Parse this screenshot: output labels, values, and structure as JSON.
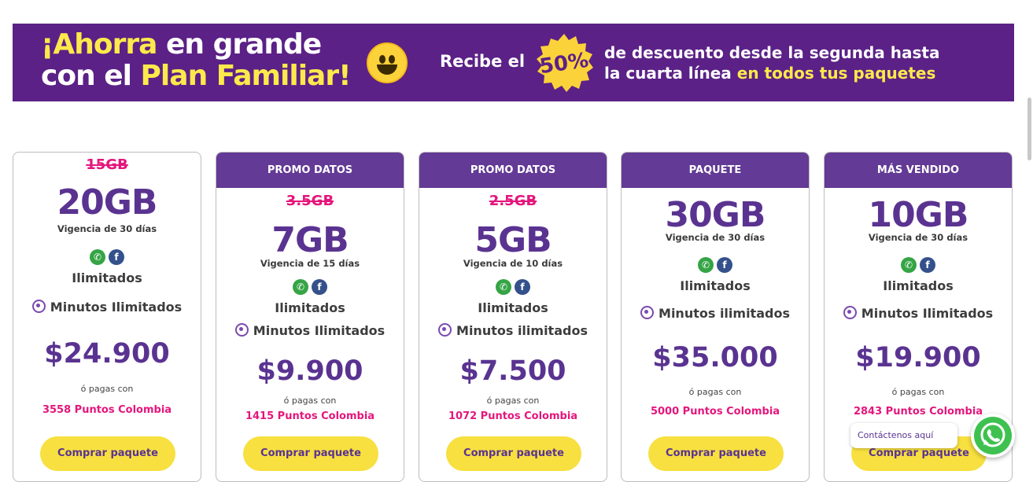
{
  "banner": {
    "line1_yellow": "¡Ahorra",
    "line1_white": "en grande",
    "line2_white": "con el",
    "line2_yellow": "Plan Familiar!",
    "recibe": "Recibe el",
    "percent": "50%",
    "desc_line1": "de descuento desde la segunda hasta",
    "desc_line2_white": "la cuarta línea",
    "desc_line2_yellow": "en todos tus paquetes",
    "bg_color": "#5b2187",
    "accent_color": "#fde94b"
  },
  "cards": [
    {
      "header": "",
      "old": "15GB",
      "gb": "20GB",
      "validity": "Vigencia de 30 días",
      "social_icons": [
        "whatsapp-icon",
        "facebook-icon"
      ],
      "unlimited": "Ilimitados",
      "minutes": "Minutos Ilimitados",
      "price": "$24.900",
      "or_pay": "ó pagas con",
      "points": "3558 Puntos Colombia",
      "button": "Comprar paquete"
    },
    {
      "header": "PROMO DATOS",
      "old": "3.5GB",
      "gb": "7GB",
      "validity": "Vigencia de 15 días",
      "social_icons": [
        "whatsapp-icon",
        "facebook-icon"
      ],
      "unlimited": "Ilimitados",
      "minutes": "Minutos Ilimitados",
      "price": "$9.900",
      "or_pay": "ó pagas con",
      "points": "1415 Puntos Colombia",
      "button": "Comprar paquete"
    },
    {
      "header": "PROMO DATOS",
      "old": "2.5GB",
      "gb": "5GB",
      "validity": "Vigencia de 10 días",
      "social_icons": [
        "whatsapp-icon",
        "facebook-icon"
      ],
      "unlimited": "Ilimitados",
      "minutes": "Minutos ilimitados",
      "price": "$7.500",
      "or_pay": "ó pagas con",
      "points": "1072 Puntos Colombia",
      "button": "Comprar paquete"
    },
    {
      "header": "PAQUETE",
      "old": "",
      "gb": "30GB",
      "validity": "Vigencia de 30 días",
      "social_icons": [
        "whatsapp-icon",
        "facebook-icon"
      ],
      "unlimited": "Ilimitados",
      "minutes": "Minutos ilimitados",
      "price": "$35.000",
      "or_pay": "ó pagas con",
      "points": "5000 Puntos Colombia",
      "button": "Comprar paquete"
    },
    {
      "header": "MÁS VENDIDO",
      "old": "",
      "gb": "10GB",
      "validity": "Vigencia de 30 días",
      "social_icons": [
        "whatsapp-icon",
        "facebook-icon"
      ],
      "unlimited": "Ilimitados",
      "minutes": "Minutos Ilimitados",
      "price": "$19.900",
      "or_pay": "ó pagas con",
      "points": "2843 Puntos Colombia",
      "button": "Comprar paquete"
    }
  ],
  "contact": {
    "label": "Contáctenos aquí",
    "icon": "whatsapp-icon"
  },
  "colors": {
    "card_header": "#633a95",
    "price": "#5a3391",
    "points": "#e4167c",
    "button": "#f7e03f"
  }
}
